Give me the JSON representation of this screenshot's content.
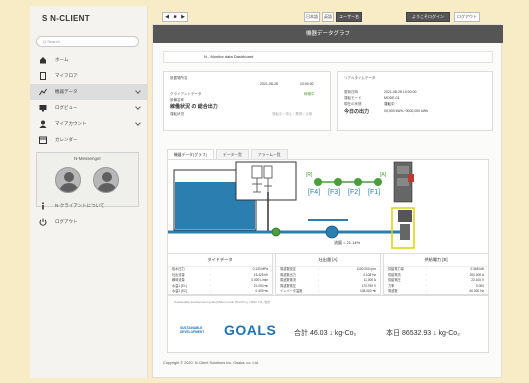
{
  "app": {
    "logo": "S N-CLIENT"
  },
  "search": {
    "placeholder": "Q Search"
  },
  "sidebar": {
    "items": [
      {
        "label": "ホーム",
        "icon": "home-icon"
      },
      {
        "label": "マイフロア",
        "icon": "tablet-icon"
      },
      {
        "label": "機器データ",
        "icon": "graph-icon",
        "active": true
      },
      {
        "label": "ログビュー",
        "icon": "monitor-icon"
      },
      {
        "label": "マイアカウント",
        "icon": "user-icon"
      },
      {
        "label": "カレンダー",
        "icon": "calendar-icon"
      }
    ],
    "messenger_title": "N-Messenger",
    "bottom_items": [
      {
        "label": "N-クライアントについて",
        "icon": "info-icon"
      },
      {
        "label": "ログアウト",
        "icon": "power-icon"
      }
    ]
  },
  "topbar": {
    "nav_buttons": [
      "◀",
      "■",
      "▶"
    ],
    "btn1": "日本語",
    "btn2": "英語",
    "btn3": "ユーザー名",
    "btn4": "ようこそログイン",
    "btn5": "ログアウト"
  },
  "main": {
    "header": "機器データグラフ",
    "breadcrumb": "N - Monitor data Dashboard",
    "info_left": {
      "label1": "設置場所名",
      "date": "2021-08-28",
      "time": "10:00:00",
      "label2": "クライアントデータ",
      "status": "稼働中",
      "label3": "設備名称",
      "name": "稼働状況 の 総合出力",
      "label4": "運転状況",
      "val4": "運転中 / 停止 / 異常 / 点検"
    },
    "info_right": {
      "title": "リアルタイムデータ",
      "k1": "更新日時",
      "v1": "2021-08-28 10:00:00",
      "k2": "運転モード",
      "v2": "MODE-01",
      "k3": "現在の状態",
      "v3": "運転中",
      "k4": "今日の出力",
      "v4": "00,000 kWh / 0000,000 kWh"
    },
    "tabs": [
      "機器データ(グラフ)",
      "データ一覧",
      "アラーム一覧"
    ],
    "diagram": {
      "pumps": [
        "[F4]",
        "[F3]",
        "[F2]",
        "[F1]"
      ],
      "tag_left": "[R]",
      "tag_right": "[A]",
      "flow": "流量 = 21.14%"
    },
    "panels": [
      {
        "title": "タイドデータ",
        "rows": [
          {
            "k": "吸水圧力",
            "v": "0.133 MPa"
          },
          {
            "k": "吐出流量",
            "v": "15.425 t/h"
          },
          {
            "k": "瞬時流量",
            "v": "0.000 L/min"
          },
          {
            "k": "水温1 [E1]",
            "v": "21.000 ℃"
          },
          {
            "k": "水温2 [E2]",
            "v": "0.409 ℃"
          }
        ]
      },
      {
        "title": "吐出量 [A]",
        "rows": [
          {
            "k": "周波数設定",
            "v": "1100.000 rpm"
          },
          {
            "k": "周波数出力",
            "v": "0.108 Hz"
          },
          {
            "k": "周波数電流",
            "v": "11.000 A"
          },
          {
            "k": "周波数電圧",
            "v": "170.790 V"
          },
          {
            "k": "インバータ温度",
            "v": "108.000 ℃"
          }
        ]
      },
      {
        "title": "供給電力 [B]",
        "rows": [
          {
            "k": "供給電力量",
            "v": "0.365 kW"
          },
          {
            "k": "供給電流",
            "v": "200.000 A"
          },
          {
            "k": "供給電圧",
            "v": "22.100 V"
          },
          {
            "k": "力率",
            "v": "0.000"
          },
          {
            "k": "周波数",
            "v": "60.000 Hz"
          }
        ]
      }
    ],
    "sdg": {
      "note": "Sustainable development goals(SDGs) result (Tex/CO₂) / SDG CO₂ 合計",
      "small": "SUSTAINABLE\nDEVELOPMENT",
      "goals": "GOALS",
      "total": "合計 46.03 ↓ kg-Co₂",
      "today": "本日 86532.93 ↓ kg-Co₂"
    },
    "copyright": "Copyright © 2020. N-Client Solutions Inc. Osaka. co. Ltd."
  },
  "colors": {
    "accent_green": "#4c9e3c",
    "water_blue": "#2a7fb0",
    "header_dark": "#555555",
    "sdg_blue": "#1d72b8"
  }
}
